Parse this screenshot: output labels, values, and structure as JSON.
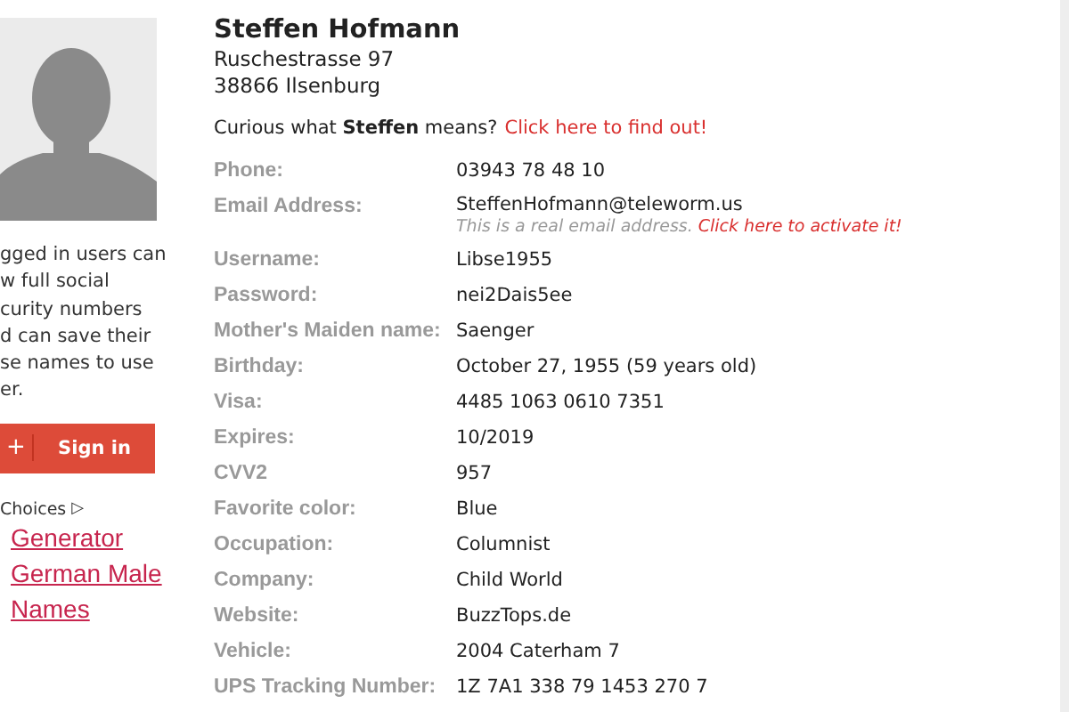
{
  "sidebar": {
    "notice_lines": [
      "gged in users can",
      "w full social",
      "curity numbers",
      "d can save their",
      "se names to use",
      "er."
    ],
    "signin_button": {
      "icon": "+",
      "label": "Sign in"
    },
    "ad_choices": {
      "label": "Choices",
      "icon": "▷"
    },
    "links": [
      "Generator",
      "German Male",
      "Names"
    ]
  },
  "person": {
    "name": "Steffen Hofmann",
    "address_lines": [
      "Ruschestrasse 97",
      "38866 Ilsenburg"
    ],
    "curious": {
      "text": "Curious what **Steffen** means?",
      "link": "Click here to find out!"
    }
  },
  "details": [
    {
      "label": "Phone:",
      "value": "03943 78 48 10"
    },
    {
      "label": "Email Address:",
      "value": "SteffenHofmann@teleworm.us",
      "note": "This is a real email address.",
      "note_link": "Click here to activate it!"
    },
    {
      "label": "Username:",
      "value": "Libse1955"
    },
    {
      "label": "Password:",
      "value": "nei2Dais5ee"
    },
    {
      "label": "Mother's Maiden name:",
      "value": "Saenger"
    },
    {
      "label": "Birthday:",
      "value": "October 27, 1955 (59 years old)"
    },
    {
      "label": "Visa:",
      "value": "4485 1063 0610 7351"
    },
    {
      "label": "Expires:",
      "value": "10/2019"
    },
    {
      "label": "CVV2",
      "value": "957"
    },
    {
      "label": "Favorite color:",
      "value": "Blue"
    },
    {
      "label": "Occupation:",
      "value": "Columnist"
    },
    {
      "label": "Company:",
      "value": "Child World"
    },
    {
      "label": "Website:",
      "value": "BuzzTops.de"
    },
    {
      "label": "Vehicle:",
      "value": "2004 Caterham 7"
    },
    {
      "label": "UPS Tracking Number:",
      "value": "1Z 7A1 338 79 1453 270 7"
    }
  ]
}
